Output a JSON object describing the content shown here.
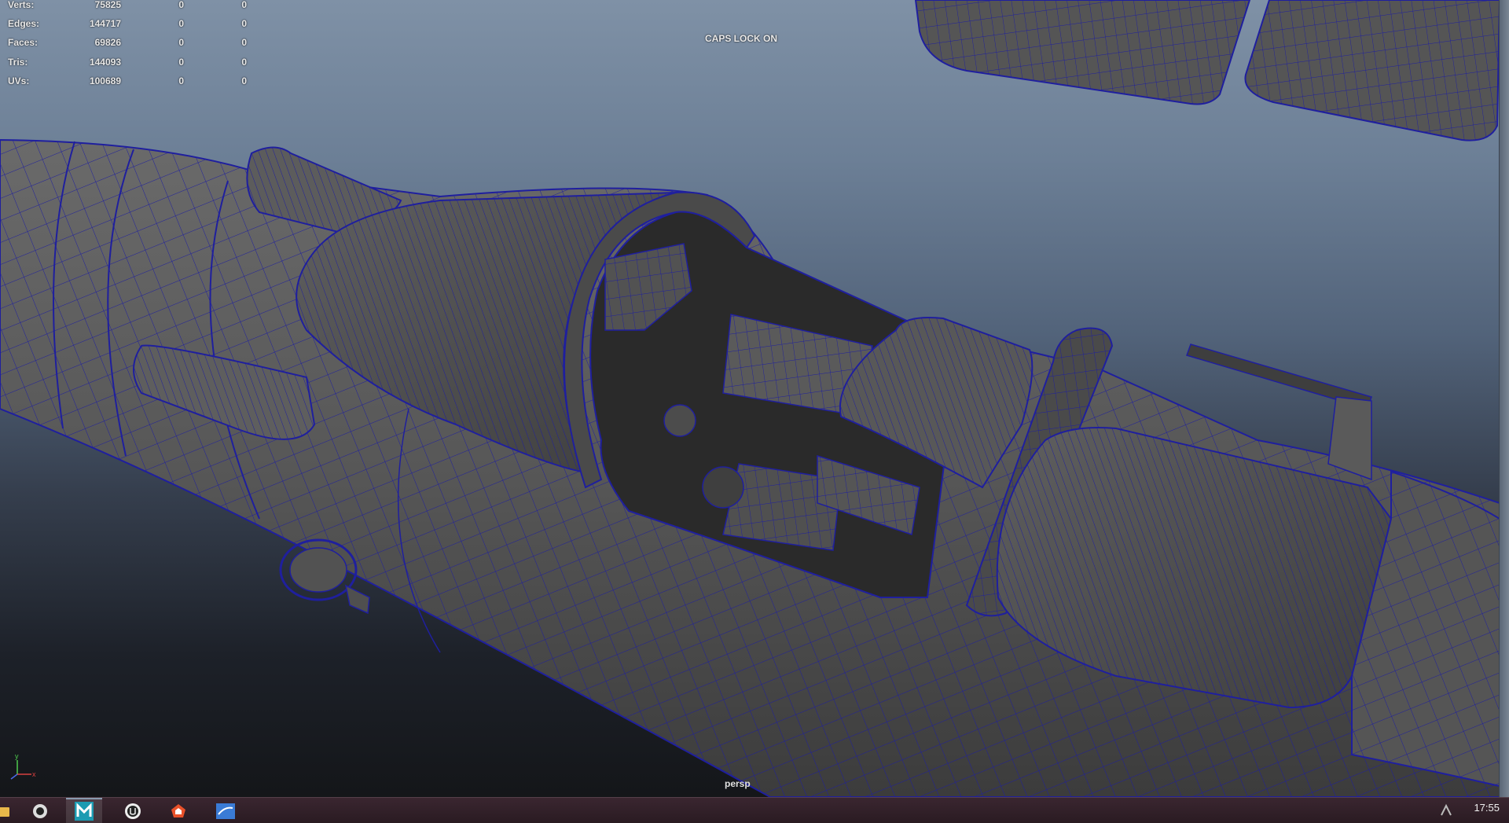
{
  "stats": {
    "rows": [
      {
        "label": "Verts:",
        "v1": "75825",
        "v2": "0",
        "v3": "0"
      },
      {
        "label": "Edges:",
        "v1": "144717",
        "v2": "0",
        "v3": "0"
      },
      {
        "label": "Faces:",
        "v1": "69826",
        "v2": "0",
        "v3": "0"
      },
      {
        "label": "Tris:",
        "v1": "144093",
        "v2": "0",
        "v3": "0"
      },
      {
        "label": "UVs:",
        "v1": "100689",
        "v2": "0",
        "v3": "0"
      }
    ]
  },
  "caps_lock": "CAPS LOCK ON",
  "camera": "persp",
  "axis": {
    "y": "y",
    "x": "x"
  },
  "taskbar": {
    "clock": "17:55",
    "icons": [
      "file-explorer-icon",
      "obs-icon",
      "maya-icon",
      "unreal-engine-icon",
      "houdini-icon",
      "substance-icon"
    ]
  },
  "colors": {
    "wire": "#1f1f9e",
    "mesh_fill": "#4e4e4e",
    "mesh_light": "#6a6a6a",
    "mesh_dark": "#2e2e2e"
  }
}
